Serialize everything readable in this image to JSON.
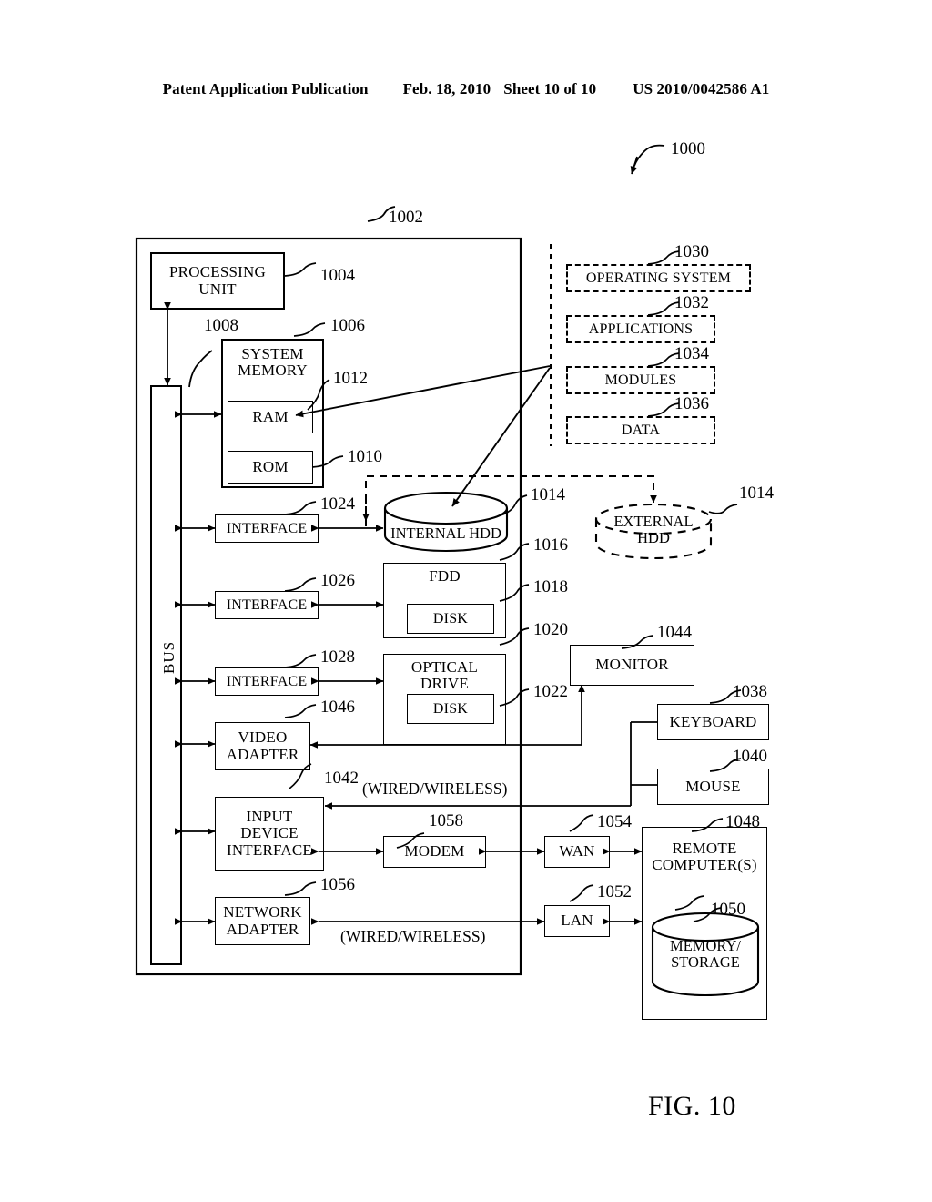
{
  "header": {
    "publication": "Patent Application Publication",
    "date": "Feb. 18, 2010",
    "sheet": "Sheet 10 of 10",
    "number": "US 2010/0042586 A1"
  },
  "figure": {
    "caption": "FIG. 10",
    "system_ref": "1000"
  },
  "computer": {
    "ref": "1002",
    "bus": {
      "label": "BUS",
      "ref": "1008"
    },
    "processing_unit": {
      "label": "PROCESSING UNIT",
      "line1": "PROCESSING",
      "line2": "UNIT",
      "ref": "1004"
    },
    "system_memory": {
      "label": "SYSTEM MEMORY",
      "line1": "SYSTEM",
      "line2": "MEMORY",
      "ref": "1006"
    },
    "ram": {
      "label": "RAM",
      "ref": "1012"
    },
    "rom": {
      "label": "ROM",
      "ref": "1010"
    },
    "interface_hdd": {
      "label": "INTERFACE",
      "ref": "1024"
    },
    "interface_fdd": {
      "label": "INTERFACE",
      "ref": "1026"
    },
    "interface_optical": {
      "label": "INTERFACE",
      "ref": "1028"
    },
    "internal_hdd": {
      "label": "INTERNAL HDD",
      "ref": "1014"
    },
    "external_hdd": {
      "label": "EXTERNAL HDD",
      "line1": "EXTERNAL",
      "line2": "HDD",
      "ref": "1014"
    },
    "fdd": {
      "label": "FDD",
      "ref": "1016"
    },
    "fdd_disk": {
      "label": "DISK",
      "ref": "1018"
    },
    "optical_drive": {
      "label": "OPTICAL DRIVE",
      "line1": "OPTICAL",
      "line2": "DRIVE",
      "ref": "1020"
    },
    "optical_disk": {
      "label": "DISK",
      "ref": "1022"
    },
    "video_adapter": {
      "label": "VIDEO ADAPTER",
      "line1": "VIDEO",
      "line2": "ADAPTER",
      "ref": "1046"
    },
    "input_device_interface": {
      "label": "INPUT DEVICE INTERFACE",
      "line1": "INPUT",
      "line2": "DEVICE",
      "line3": "INTERFACE",
      "ref": "1042"
    },
    "network_adapter": {
      "label": "NETWORK ADAPTER",
      "line1": "NETWORK",
      "line2": "ADAPTER",
      "ref": "1056"
    },
    "modem": {
      "label": "MODEM",
      "ref": "1058"
    }
  },
  "software": {
    "operating_system": {
      "label": "OPERATING SYSTEM",
      "ref": "1030"
    },
    "applications": {
      "label": "APPLICATIONS",
      "ref": "1032"
    },
    "modules": {
      "label": "MODULES",
      "ref": "1034"
    },
    "data": {
      "label": "DATA",
      "ref": "1036"
    }
  },
  "peripherals": {
    "monitor": {
      "label": "MONITOR",
      "ref": "1044"
    },
    "keyboard": {
      "label": "KEYBOARD",
      "ref": "1038"
    },
    "mouse": {
      "label": "MOUSE",
      "ref": "1040"
    }
  },
  "network": {
    "wan": {
      "label": "WAN",
      "ref": "1054"
    },
    "lan": {
      "label": "LAN",
      "ref": "1052"
    },
    "remote_computers": {
      "label": "REMOTE COMPUTER(S)",
      "line1": "REMOTE",
      "line2": "COMPUTER(S)",
      "ref": "1048"
    },
    "memory_storage": {
      "label": "MEMORY/ STORAGE",
      "line1": "MEMORY/",
      "line2": "STORAGE",
      "ref": "1050"
    },
    "wired_wireless_input": "(WIRED/WIRELESS)",
    "wired_wireless_network": "(WIRED/WIRELESS)"
  }
}
